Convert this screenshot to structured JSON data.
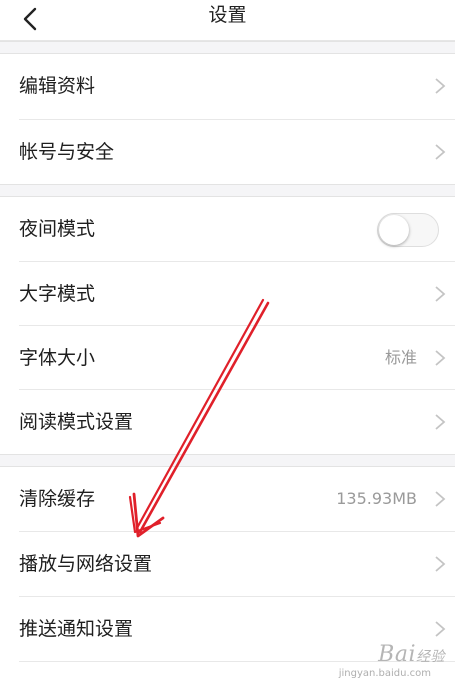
{
  "header": {
    "title": "设置",
    "back_icon": "chevron-left-icon"
  },
  "groups": [
    {
      "items": [
        {
          "label": "编辑资料",
          "value": "",
          "control": "chevron"
        },
        {
          "label": "帐号与安全",
          "value": "",
          "control": "chevron"
        }
      ]
    },
    {
      "items": [
        {
          "label": "夜间模式",
          "value": "",
          "control": "toggle",
          "toggle_on": false
        },
        {
          "label": "大字模式",
          "value": "",
          "control": "chevron"
        },
        {
          "label": "字体大小",
          "value": "标准",
          "control": "chevron"
        },
        {
          "label": "阅读模式设置",
          "value": "",
          "control": "chevron"
        }
      ]
    },
    {
      "items": [
        {
          "label": "清除缓存",
          "value": "135.93MB",
          "control": "chevron"
        },
        {
          "label": "播放与网络设置",
          "value": "",
          "control": "chevron"
        },
        {
          "label": "推送通知设置",
          "value": "",
          "control": "chevron"
        }
      ]
    }
  ],
  "annotation": {
    "type": "red-arrow",
    "color": "#e0202a",
    "points_to": "播放与网络设置"
  },
  "watermark": {
    "text": "Bai经验",
    "sub": "jingyan.baidu.com"
  },
  "colors": {
    "background": "#ffffff",
    "section_gap": "#f5f5f7",
    "text_primary": "#1f1f1f",
    "text_secondary": "#9a9a9a"
  }
}
